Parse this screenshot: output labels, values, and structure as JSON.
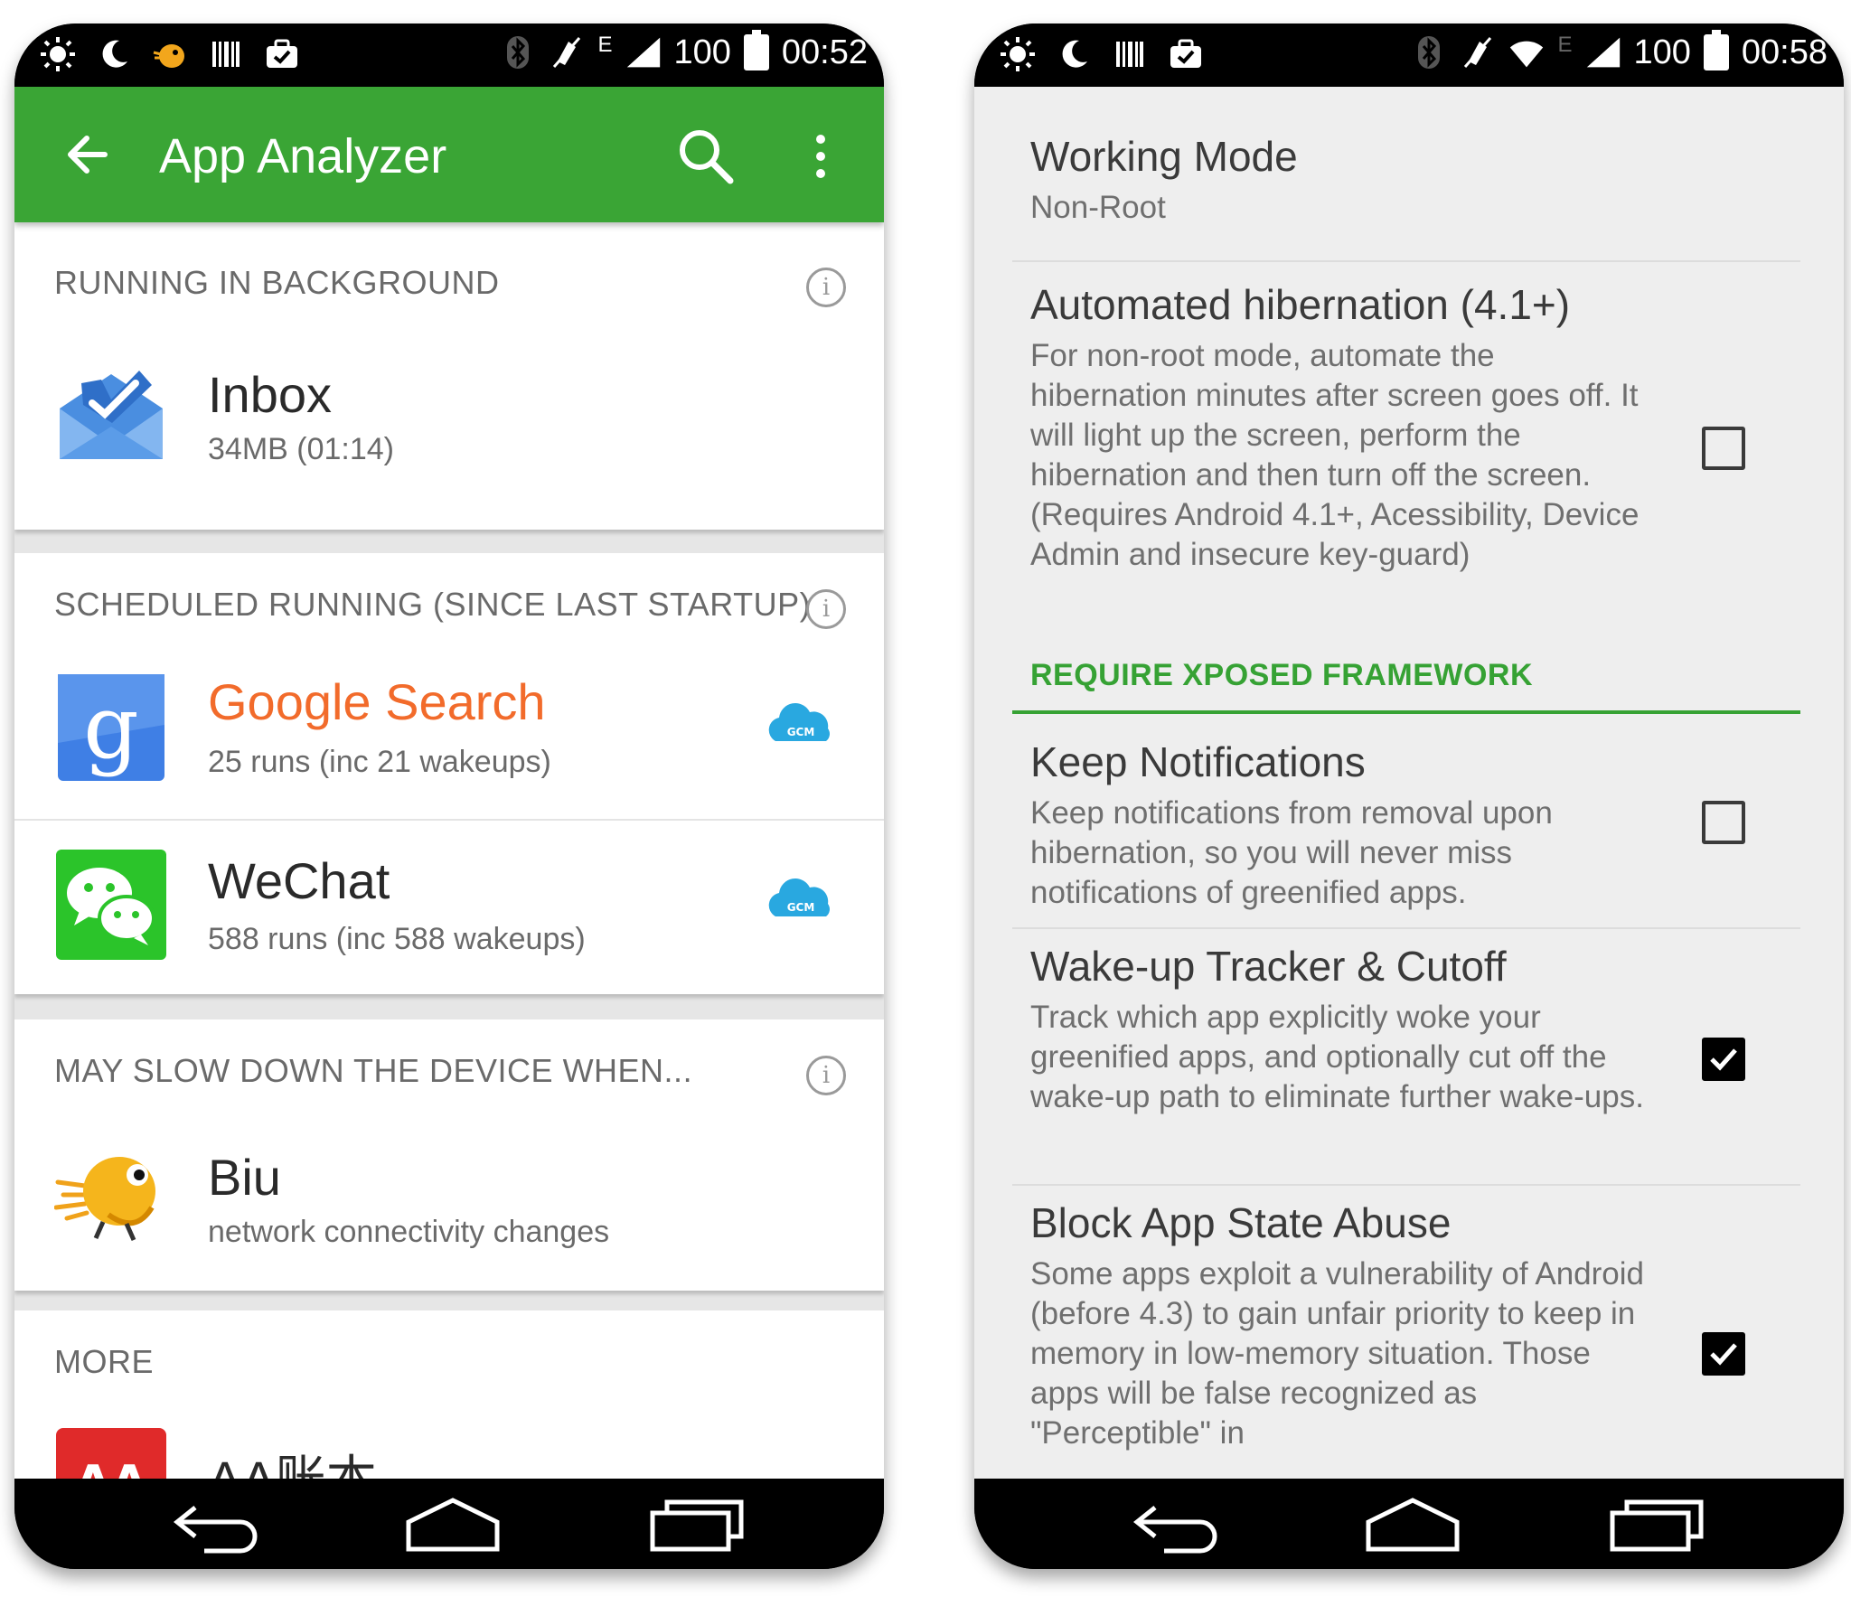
{
  "left": {
    "status_bar": {
      "battery": "100",
      "time": "00:52",
      "network": "E"
    },
    "app_bar": {
      "title": "App Analyzer"
    },
    "sections": [
      {
        "header": "RUNNING IN BACKGROUND",
        "apps": [
          {
            "name": "Inbox",
            "detail": "34MB (01:14)",
            "icon": "inbox-icon"
          }
        ]
      },
      {
        "header": "SCHEDULED RUNNING (SINCE LAST STARTUP)",
        "apps": [
          {
            "name": "Google Search",
            "detail": "25 runs (inc 21 wakeups)",
            "icon": "google-search-icon",
            "name_color": "#f26b2b"
          },
          {
            "name": "WeChat",
            "detail": "588 runs (inc 588 wakeups)",
            "icon": "wechat-icon"
          }
        ]
      },
      {
        "header": "MAY SLOW DOWN THE DEVICE WHEN...",
        "apps": [
          {
            "name": "Biu",
            "detail": "network connectivity changes",
            "icon": "biu-bird-icon"
          }
        ]
      },
      {
        "header": "MORE",
        "apps": [
          {
            "name": "AA账本",
            "icon": "aa-ledger-icon"
          }
        ]
      }
    ]
  },
  "right": {
    "status_bar": {
      "battery": "100",
      "time": "00:58",
      "network": "E"
    },
    "prefs": [
      {
        "title": "Working Mode",
        "summary": "Non-Root"
      },
      {
        "title": "Automated hibernation (4.1+)",
        "summary": "For non-root mode, automate the hibernation minutes after screen goes off. It will light up the screen, perform the hibernation and then turn off the screen. (Requires Android 4.1+, Acessibility, Device Admin and insecure key-guard)",
        "checked": false
      }
    ],
    "category": "REQUIRE XPOSED FRAMEWORK",
    "xposed_prefs": [
      {
        "title": "Keep Notifications",
        "summary": "Keep notifications from removal upon hibernation, so you will never miss notifications of greenified apps.",
        "checked": false
      },
      {
        "title": "Wake-up Tracker & Cutoff",
        "summary": "Track which app explicitly woke your greenified apps, and optionally cut off the wake-up path to eliminate further wake-ups.",
        "checked": true
      },
      {
        "title": "Block App State Abuse",
        "summary": "Some apps exploit a vulnerability of Android (before 4.3) to gain unfair priority to keep in memory in low-memory situation. Those apps will be false recognized as \"Perceptible\" in",
        "checked": true
      }
    ]
  },
  "colors": {
    "app_bar": "#3aa535",
    "accent_orange": "#f26b2b",
    "category_green": "#36a234"
  }
}
